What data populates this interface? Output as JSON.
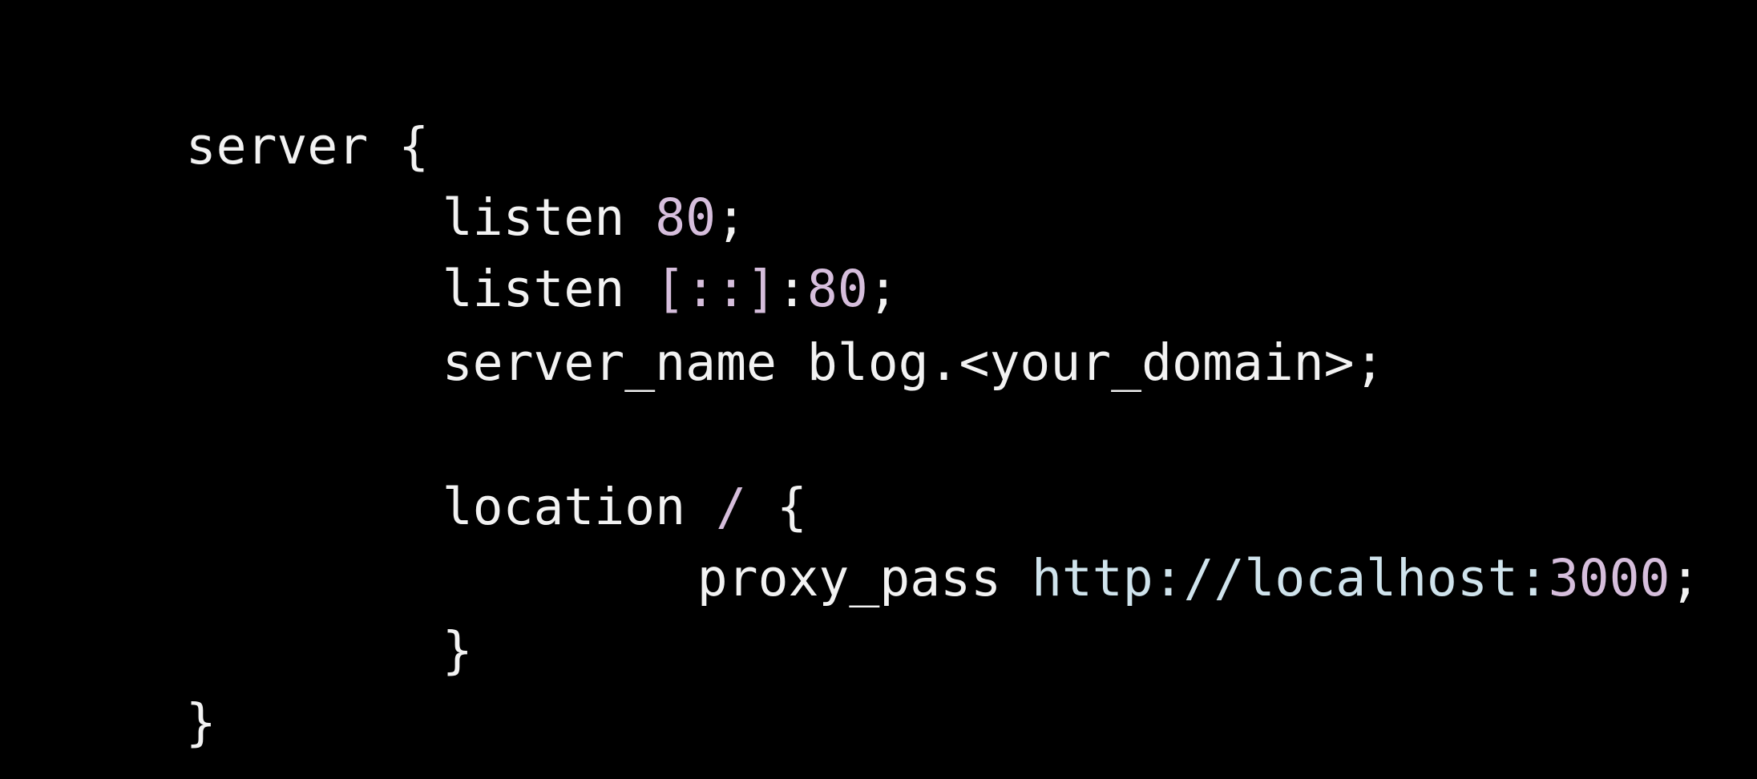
{
  "code": {
    "line1": {
      "keyword": "server",
      "space": " ",
      "brace": "{"
    },
    "line2": {
      "directive": "listen",
      "space": " ",
      "port": "80",
      "semi": ";"
    },
    "line3": {
      "directive": "listen",
      "space": " ",
      "addr": "[::]",
      "colon": ":",
      "port": "80",
      "semi": ";"
    },
    "line4": {
      "directive": "server_name",
      "space": " ",
      "value": "blog.<your_domain>",
      "semi": ";"
    },
    "line6": {
      "directive": "location",
      "space": " ",
      "path": "/",
      "space2": " ",
      "brace": "{"
    },
    "line7": {
      "directive": "proxy_pass",
      "space": " ",
      "url": "http://localhost:",
      "port": "3000",
      "semi": ";"
    },
    "line8": {
      "brace": "}"
    },
    "line9": {
      "brace": "}"
    }
  },
  "colors": {
    "background": "#000000",
    "text": "#f2f2f2",
    "number": "#d6bedc",
    "url": "#cfe3ec"
  }
}
